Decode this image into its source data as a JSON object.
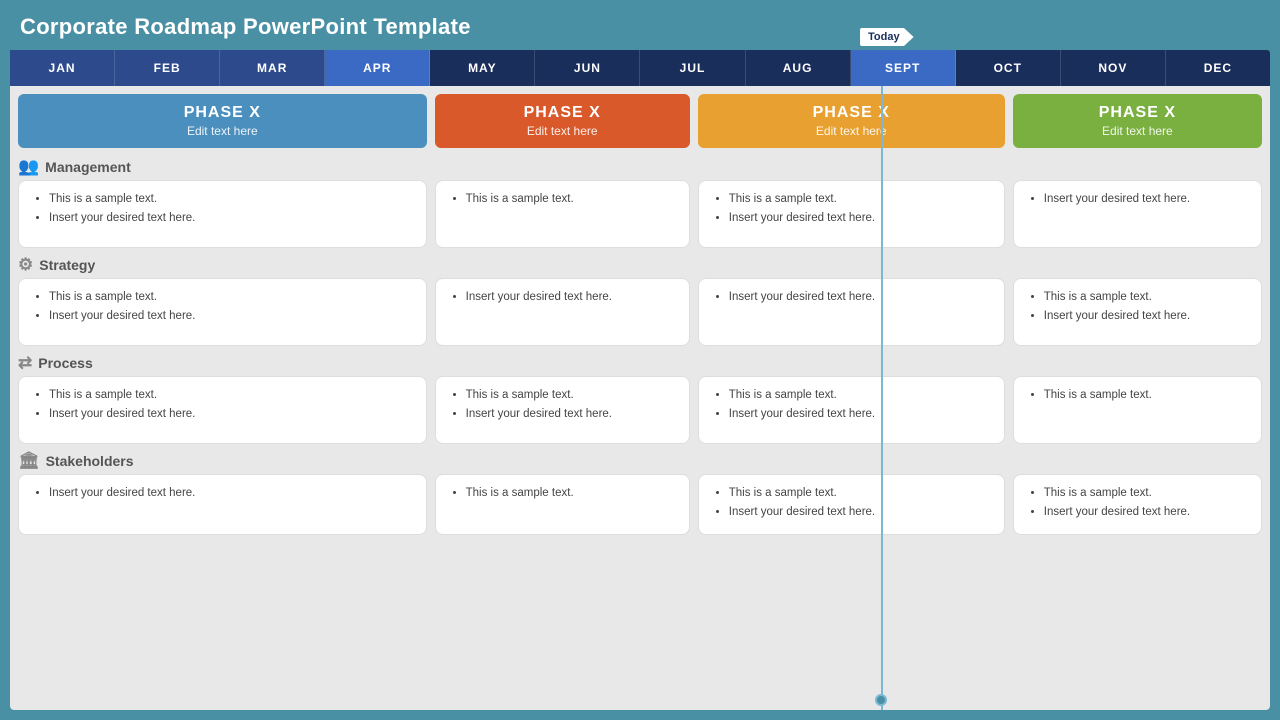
{
  "title": "Corporate Roadmap PowerPoint Template",
  "today_label": "Today",
  "months": [
    {
      "label": "JAN",
      "active": false
    },
    {
      "label": "FEB",
      "active": false
    },
    {
      "label": "MAR",
      "active": false
    },
    {
      "label": "APR",
      "active": true
    },
    {
      "label": "MAY",
      "active": false
    },
    {
      "label": "JUN",
      "active": false
    },
    {
      "label": "JUL",
      "active": false
    },
    {
      "label": "AUG",
      "active": false
    },
    {
      "label": "SEPT",
      "active": true
    },
    {
      "label": "OCT",
      "active": false
    },
    {
      "label": "NOV",
      "active": false
    },
    {
      "label": "DEC",
      "active": false
    }
  ],
  "phases": [
    {
      "label": "PHASE X",
      "subtitle": "Edit text here",
      "color": "blue"
    },
    {
      "label": "PHASE X",
      "subtitle": "Edit text here",
      "color": "orange"
    },
    {
      "label": "PHASE X",
      "subtitle": "Edit text here",
      "color": "yellow"
    },
    {
      "label": "PHASE X",
      "subtitle": "Edit text here",
      "color": "green"
    }
  ],
  "sections": [
    {
      "name": "Management",
      "icon": "👥",
      "cards": [
        {
          "items": [
            "This is a sample text.",
            "Insert your desired text here."
          ]
        },
        {
          "items": [
            "This is a sample text."
          ]
        },
        {
          "items": [
            "This is a sample text.",
            "Insert your desired text here."
          ]
        },
        {
          "items": [
            "Insert your desired text here."
          ]
        }
      ]
    },
    {
      "name": "Strategy",
      "icon": "⚙",
      "cards": [
        {
          "items": [
            "This is a sample text.",
            "Insert your desired text here."
          ]
        },
        {
          "items": [
            "Insert your desired text here."
          ]
        },
        {
          "items": [
            "Insert your desired text here."
          ]
        },
        {
          "items": [
            "This is a sample text.",
            "Insert your desired text here."
          ]
        }
      ]
    },
    {
      "name": "Process",
      "icon": "🔀",
      "cards": [
        {
          "items": [
            "This is a sample text.",
            "Insert your desired text here."
          ]
        },
        {
          "items": [
            "This is a sample text.",
            "Insert your desired text here."
          ]
        },
        {
          "items": [
            "This is a sample text.",
            "Insert your desired text here."
          ]
        },
        {
          "items": [
            "This is a sample text."
          ]
        }
      ]
    },
    {
      "name": "Stakeholders",
      "icon": "🏛",
      "cards": [
        {
          "items": [
            "Insert your desired text here."
          ]
        },
        {
          "items": [
            "This is a sample text."
          ]
        },
        {
          "items": [
            "This is a sample text.",
            "Insert your desired text here."
          ]
        },
        {
          "items": [
            "This is a sample text.",
            "Insert your desired text here."
          ]
        }
      ]
    }
  ]
}
